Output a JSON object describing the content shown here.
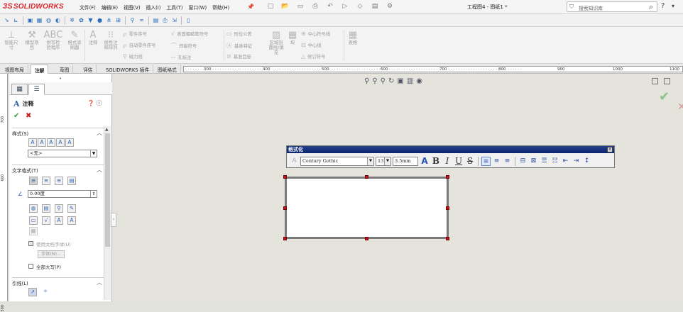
{
  "app": {
    "logo_ds": "3S",
    "logo_text": "SOLIDWORKS"
  },
  "menu": [
    "文件(F)",
    "编辑(E)",
    "视图(V)",
    "插入(I)",
    "工具(T)",
    "窗口(W)",
    "帮助(H)"
  ],
  "doc_title": "工程图4 - 图纸1 *",
  "search": {
    "placeholder": "搜索知识库"
  },
  "help": "?",
  "ribbon": {
    "smart_dim": "智能尺\n寸",
    "model_items": "模型项\n目",
    "spell": "拼写检\n验程序",
    "format_painter": "格式涂\n刷器",
    "note": "注释",
    "linear_pattern": "线性注\n释阵列",
    "balloon": "零件序号",
    "auto_balloon": "自动零件序号",
    "magnetic": "磁力线",
    "surface_finish": "表面粗糙度符号",
    "weld": "焊接符号",
    "hole_callout": "孔标注",
    "gtol": "形位公差",
    "datum_feature": "基准特征",
    "datum_target": "基准目标",
    "hatch": "区域剖\n面线/填\n充",
    "block": "块",
    "centermark": "中心符号线",
    "centerline": "中心线",
    "revision": "修订符号",
    "tables": "表格"
  },
  "tabs": [
    "视图布局",
    "注解",
    "草图",
    "评估",
    "SOLIDWORKS 插件",
    "图纸格式"
  ],
  "ruler_top": [
    "300",
    "400",
    "500",
    "600",
    "700",
    "800",
    "900",
    "1000",
    "1100"
  ],
  "ruler_left": [
    "700",
    "600",
    "500"
  ],
  "panel": {
    "title": "注释",
    "style_section": "样式(S)",
    "style_value": "<无>",
    "text_format_section": "文字格式(T)",
    "angle": "0.00度",
    "use_doc_font": "使用文档字体(U)",
    "font_button": "字体(N)...",
    "all_caps": "全部大写(P)",
    "leader_section": "引线(L)"
  },
  "format_toolbar": {
    "title": "格式化",
    "font": "Century Gothic",
    "size": "13",
    "height": "3.5mm",
    "close": "x"
  }
}
